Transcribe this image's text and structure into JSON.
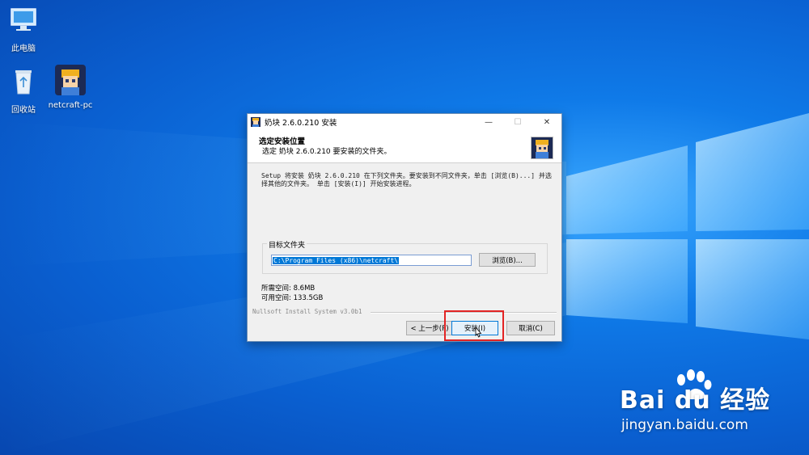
{
  "desktop": {
    "icons": [
      {
        "label": "此电脑",
        "icon": "computer-icon"
      },
      {
        "label": "回收站",
        "icon": "recycle-bin-icon"
      },
      {
        "label": "netcraft-pc",
        "icon": "netcraft-app-icon"
      }
    ]
  },
  "installer": {
    "title": "奶块 2.6.0.210 安装",
    "window_controls": {
      "minimize": "—",
      "maximize": "☐",
      "close": "✕"
    },
    "header_title": "选定安装位置",
    "header_subtitle": "选定 奶块 2.6.0.210 要安装的文件夹。",
    "description": "Setup 将安装 奶块 2.6.0.210 在下列文件夹。要安装到不同文件夹，单击 [浏览(B)...] 并选择其他的文件夹。 单击 [安装(I)] 开始安装进程。",
    "group_label": "目标文件夹",
    "path_value": "C:\\Program Files (x86)\\netcraft\\",
    "browse_label": "浏览(B)...",
    "space_required": "所需空间: 8.6MB",
    "space_available": "可用空间: 133.5GB",
    "branding": "Nullsoft Install System v3.0b1",
    "buttons": {
      "back": "< 上一步(P)",
      "install": "安装(I)",
      "cancel": "取消(C)"
    }
  },
  "watermark": {
    "brand": "Bai du 经验",
    "url": "jingyan.baidu.com"
  },
  "colors": {
    "accent": "#0078d7",
    "highlight": "#e32424"
  }
}
